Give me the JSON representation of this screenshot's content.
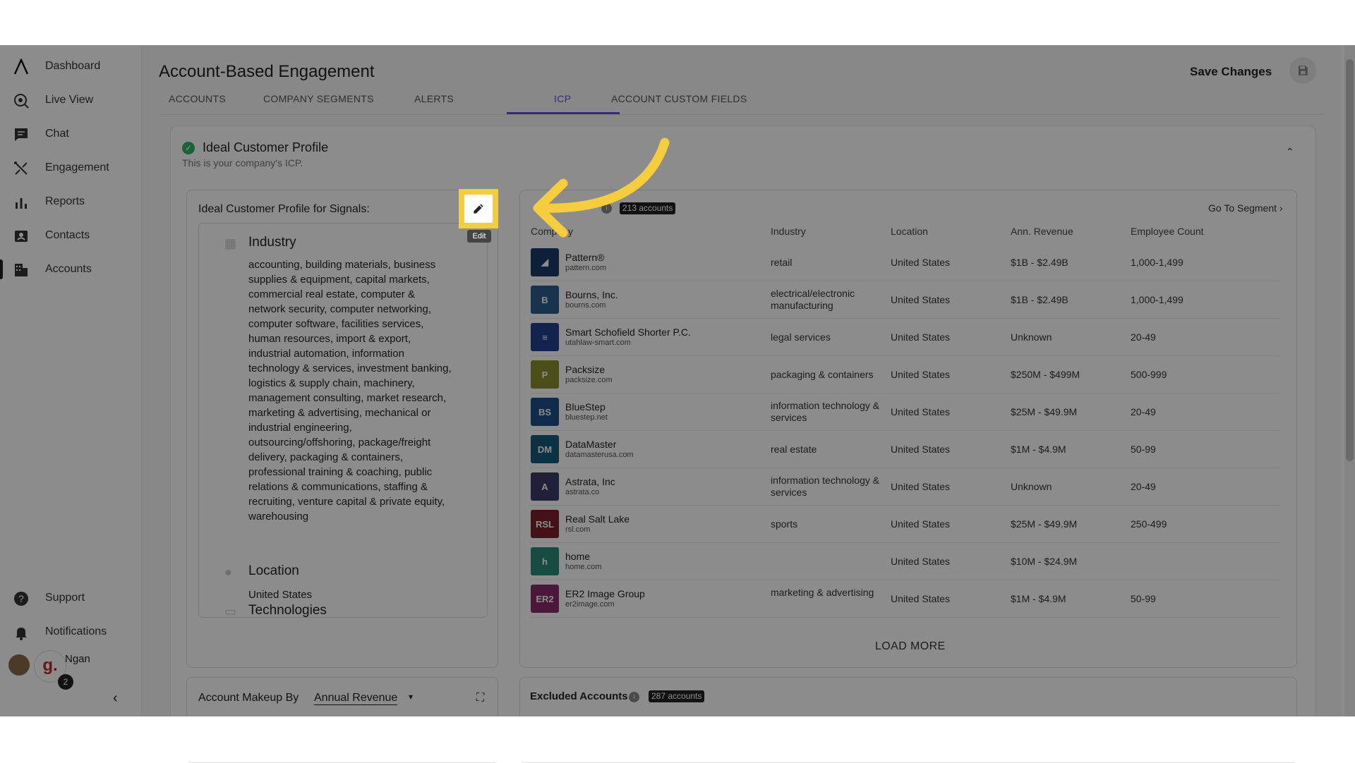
{
  "sidebar": {
    "items": [
      {
        "label": "Dashboard",
        "icon": "logo-icon"
      },
      {
        "label": "Live View",
        "icon": "live-view-icon"
      },
      {
        "label": "Chat",
        "icon": "chat-icon"
      },
      {
        "label": "Engagement",
        "icon": "engagement-icon"
      },
      {
        "label": "Reports",
        "icon": "reports-icon"
      },
      {
        "label": "Contacts",
        "icon": "contacts-icon"
      },
      {
        "label": "Accounts",
        "icon": "accounts-icon"
      }
    ],
    "support": "Support",
    "notifications": "Notifications",
    "user_name": "Ngan",
    "notif_count": "2",
    "avatar_letter": "g."
  },
  "header": {
    "title": "Account-Based Engagement",
    "save_label": "Save Changes",
    "tabs": [
      "ACCOUNTS",
      "COMPANY SEGMENTS",
      "ALERTS",
      "ICP",
      "ACCOUNT CUSTOM FIELDS"
    ],
    "active_tab": "ICP"
  },
  "icp": {
    "title": "Ideal Customer Profile",
    "subtitle": "This is your company's ICP.",
    "signals_title": "Ideal Customer Profile for Signals:",
    "edit_tooltip": "Edit",
    "industry_title": "Industry",
    "industry_text": "accounting, building materials, business supplies & equipment, capital markets, commercial real estate, computer & network security, computer networking, computer software, facilities services, human resources, import & export, industrial automation, information technology & services, investment banking, logistics & supply chain, machinery, management consulting, market research, marketing & advertising, mechanical or industrial engineering, outsourcing/offshoring, package/freight delivery, packaging & containers, professional training & coaching, public relations & communications, staffing & recruiting, venture capital & private equity, warehousing",
    "location_title": "Location",
    "location_text": "United States",
    "tech_title": "Technologies"
  },
  "accounts_panel": {
    "badge": "213 accounts",
    "goto": "Go To Segment ›",
    "headers": [
      "Company",
      "Industry",
      "Location",
      "Ann. Revenue",
      "Employee Count"
    ],
    "rows": [
      {
        "name": "Pattern®",
        "domain": "pattern.com",
        "industry": "retail",
        "location": "United States",
        "revenue": "$1B - $2.49B",
        "employees": "1,000-1,499",
        "logo_color": "#1b3a6b",
        "logo_text": "◢"
      },
      {
        "name": "Bourns, Inc.",
        "domain": "bourns.com",
        "industry": "electrical/electronic manufacturing",
        "location": "United States",
        "revenue": "$1B - $2.49B",
        "employees": "1,000-1,499",
        "logo_color": "#2a5b8c",
        "logo_text": "B"
      },
      {
        "name": "Smart Schofield Shorter P.C.",
        "domain": "utahlaw-smart.com",
        "industry": "legal services",
        "location": "United States",
        "revenue": "Unknown",
        "employees": "20-49",
        "logo_color": "#1f3f8f",
        "logo_text": "≡"
      },
      {
        "name": "Packsize",
        "domain": "packsize.com",
        "industry": "packaging & containers",
        "location": "United States",
        "revenue": "$250M - $499M",
        "employees": "500-999",
        "logo_color": "#8a8f2a",
        "logo_text": "P"
      },
      {
        "name": "BlueStep",
        "domain": "bluestep.net",
        "industry": "information technology & services",
        "location": "United States",
        "revenue": "$25M - $49.9M",
        "employees": "20-49",
        "logo_color": "#1d4f8a",
        "logo_text": "BS"
      },
      {
        "name": "DataMaster",
        "domain": "datamasterusa.com",
        "industry": "real estate",
        "location": "United States",
        "revenue": "$1M - $4.9M",
        "employees": "50-99",
        "logo_color": "#155a7a",
        "logo_text": "DM"
      },
      {
        "name": "Astrata, Inc",
        "domain": "astrata.co",
        "industry": "information technology & services",
        "location": "United States",
        "revenue": "Unknown",
        "employees": "20-49",
        "logo_color": "#3a3a6a",
        "logo_text": "A"
      },
      {
        "name": "Real Salt Lake",
        "domain": "rsl.com",
        "industry": "sports",
        "location": "United States",
        "revenue": "$25M - $49.9M",
        "employees": "250-499",
        "logo_color": "#7a1f2a",
        "logo_text": "RSL"
      },
      {
        "name": "home",
        "domain": "home.com",
        "industry": "",
        "location": "United States",
        "revenue": "$10M - $24.9M",
        "employees": "",
        "logo_color": "#2a8a7a",
        "logo_text": "h"
      },
      {
        "name": "ER2 Image Group",
        "domain": "er2image.com",
        "industry": "marketing & advertising",
        "location": "United States",
        "revenue": "$1M - $4.9M",
        "employees": "50-99",
        "logo_color": "#8a2a6a",
        "logo_text": "ER2"
      }
    ],
    "load_more": "LOAD MORE"
  },
  "bottom": {
    "makeup_title": "Account Makeup By",
    "makeup_select": "Annual Revenue",
    "excluded_title": "Excluded Accounts",
    "excluded_badge": "287 accounts"
  },
  "colors": {
    "accent": "#6a4bd1",
    "highlight": "#f6cd3f",
    "check": "#2fb36b"
  }
}
